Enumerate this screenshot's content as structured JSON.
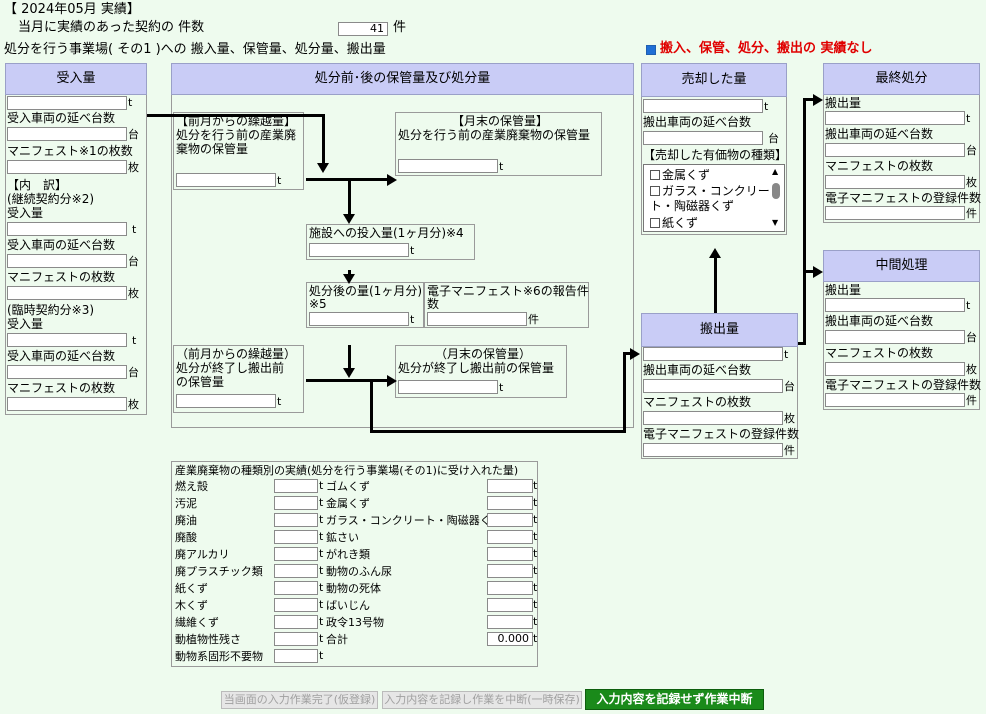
{
  "header": {
    "period": "【 2024年05月 実績】",
    "contract_label": "当月に実績のあった契約の 件数",
    "contract_count": "41",
    "contract_unit": "件",
    "facility_label": "処分を行う事業場( その1 )への 搬入量、保管量、処分量、搬出量",
    "no_result_label": "搬入、保管、処分、搬出の 実績なし"
  },
  "units": {
    "t": "t",
    "dai": "台",
    "mai": "枚",
    "ken": "件"
  },
  "receive": {
    "title": "受入量",
    "vehicles": "受入車両の延べ台数",
    "manifest1": "マニフェスト※1の枚数",
    "breakdown": "【内　訳】",
    "continuing": "(継続契約分※2)",
    "amount": "受入量",
    "vehicles2": "受入車両の延べ台数",
    "manifest": "マニフェストの枚数",
    "temporary": "(臨時契約分※3)",
    "amount2": "受入量",
    "vehicles3": "受入車両の延べ台数",
    "manifest2": "マニフェストの枚数"
  },
  "storage": {
    "title": "処分前･後の保管量及び処分量",
    "prev_before_l1": "【前月からの繰越量】",
    "prev_before_l2": "処分を行う前の産業廃",
    "prev_before_l3": "棄物の保管量",
    "end_before_l1": "【月末の保管量】",
    "end_before_l2": "処分を行う前の産業廃棄物の保管量",
    "input_label": "施設への投入量(1ヶ月分)※4",
    "after_l1": "処分後の量(1ヶ月分)",
    "after_l2": "※5",
    "emanifest_l1": "電子マニフェスト※6の報告件",
    "emanifest_l2": "数",
    "prev_after_l1": "（前月からの繰越量）",
    "prev_after_l2": "処分が終了し搬出前",
    "prev_after_l3": "の保管量",
    "end_after_l1": "（月末の保管量）",
    "end_after_l2": "処分が終了し搬出前の保管量"
  },
  "sold": {
    "title": "売却した量",
    "vehicles": "搬出車両の延べ台数",
    "kinds": "【売却した有価物の種類】",
    "items": [
      "金属くず",
      "ガラス・コンクリー",
      "ト・陶磁器くず",
      "紙くず"
    ]
  },
  "carryout": {
    "title": "搬出量",
    "vehicles": "搬出車両の延べ台数",
    "manifest": "マニフェストの枚数",
    "emanifest": "電子マニフェストの登録件数"
  },
  "final": {
    "title": "最終処分",
    "amount": "搬出量",
    "vehicles": "搬出車両の延べ台数",
    "manifest": "マニフェストの枚数",
    "emanifest": "電子マニフェストの登録件数"
  },
  "middle": {
    "title": "中間処理",
    "amount": "搬出量",
    "vehicles": "搬出車両の延べ台数",
    "manifest": "マニフェストの枚数",
    "emanifest": "電子マニフェストの登録件数"
  },
  "waste": {
    "title": "産業廃棄物の種類別の実績(処分を行う事業場(その1)に受け入れた量)",
    "left": [
      "燃え殻",
      "汚泥",
      "廃油",
      "廃酸",
      "廃アルカリ",
      "廃プラスチック類",
      "紙くず",
      "木くず",
      "繊維くず",
      "動植物性残さ",
      "動物系固形不要物"
    ],
    "right": [
      "ゴムくず",
      "金属くず",
      "ガラス・コンクリート・陶磁器くず",
      "鉱さい",
      "がれき類",
      "動物のふん尿",
      "動物の死体",
      "ばいじん",
      "政令13号物",
      "合計"
    ],
    "total_value": "0.000"
  },
  "buttons": {
    "temp_done": "当画面の入力作業完了(仮登録)",
    "save_suspend": "入力内容を記録し作業を中断(一時保存)",
    "discard_suspend": "入力内容を記録せず作業中断"
  }
}
